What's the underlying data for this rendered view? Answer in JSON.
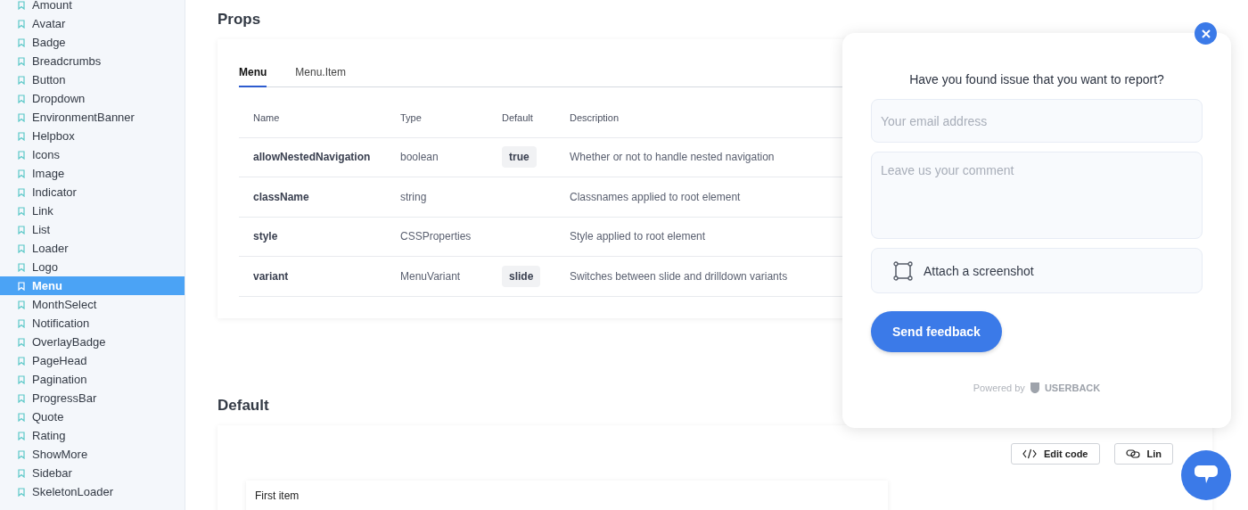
{
  "sidebar": {
    "items": [
      {
        "label": "Amount",
        "selected": false
      },
      {
        "label": "Avatar",
        "selected": false
      },
      {
        "label": "Badge",
        "selected": false
      },
      {
        "label": "Breadcrumbs",
        "selected": false
      },
      {
        "label": "Button",
        "selected": false
      },
      {
        "label": "Dropdown",
        "selected": false
      },
      {
        "label": "EnvironmentBanner",
        "selected": false
      },
      {
        "label": "Helpbox",
        "selected": false
      },
      {
        "label": "Icons",
        "selected": false
      },
      {
        "label": "Image",
        "selected": false
      },
      {
        "label": "Indicator",
        "selected": false
      },
      {
        "label": "Link",
        "selected": false
      },
      {
        "label": "List",
        "selected": false
      },
      {
        "label": "Loader",
        "selected": false
      },
      {
        "label": "Logo",
        "selected": false
      },
      {
        "label": "Menu",
        "selected": true
      },
      {
        "label": "MonthSelect",
        "selected": false
      },
      {
        "label": "Notification",
        "selected": false
      },
      {
        "label": "OverlayBadge",
        "selected": false
      },
      {
        "label": "PageHead",
        "selected": false
      },
      {
        "label": "Pagination",
        "selected": false
      },
      {
        "label": "ProgressBar",
        "selected": false
      },
      {
        "label": "Quote",
        "selected": false
      },
      {
        "label": "Rating",
        "selected": false
      },
      {
        "label": "ShowMore",
        "selected": false
      },
      {
        "label": "Sidebar",
        "selected": false
      },
      {
        "label": "SkeletonLoader",
        "selected": false
      }
    ]
  },
  "props": {
    "title": "Props",
    "tabs": [
      {
        "label": "Menu",
        "selected": true
      },
      {
        "label": "Menu.Item",
        "selected": false
      }
    ],
    "columns": [
      "Name",
      "Type",
      "Default",
      "Description"
    ],
    "rows": [
      {
        "name": "allowNestedNavigation",
        "type": "boolean",
        "default": "true",
        "description": "Whether or not to handle nested navigation"
      },
      {
        "name": "className",
        "type": "string",
        "description": "Classnames applied to root element"
      },
      {
        "name": "style",
        "type": "CSSProperties",
        "description": "Style applied to root element"
      },
      {
        "name": "variant",
        "type": "MenuVariant",
        "default": "slide",
        "description": "Switches between slide and drilldown variants"
      }
    ]
  },
  "example": {
    "title": "Default",
    "buttons": [
      {
        "kind": "code",
        "label": "Edit code"
      },
      {
        "kind": "link",
        "label": "Lin"
      }
    ],
    "preview_item": "First item"
  },
  "feedback": {
    "question": "Have you found issue that you want to report?",
    "email_placeholder": "Your email address",
    "comment_placeholder": "Leave us your comment",
    "attach": "Attach a screenshot",
    "send": "Send feedback",
    "powered_by": "Powered by",
    "brand": "USERBACK"
  }
}
